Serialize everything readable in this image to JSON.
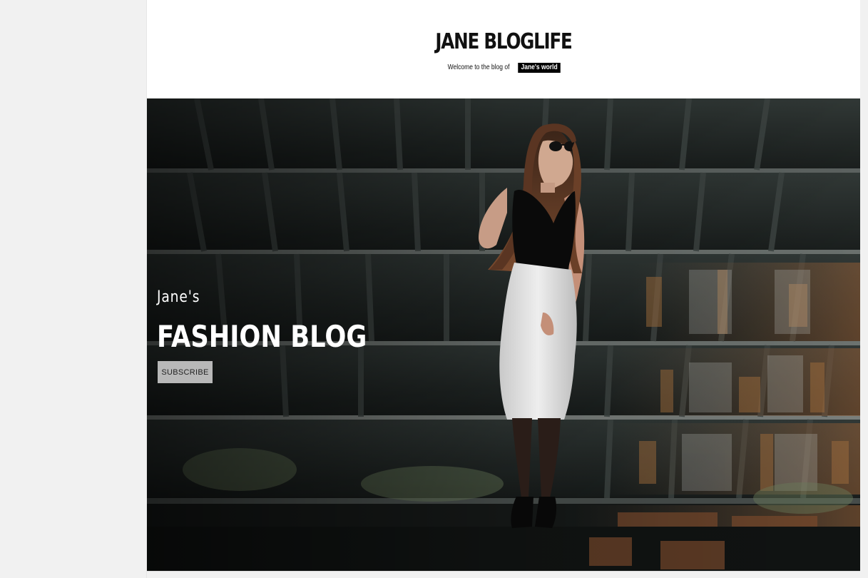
{
  "header": {
    "site_title": "JANE BLOGLIFE",
    "tagline_prefix": "Welcome to the blog of",
    "tagline_highlight": "Jane's world"
  },
  "hero": {
    "kicker": "Jane's",
    "title": "FASHION BLOG",
    "subscribe_label": "SUBSCRIBE",
    "image_alt": "woman-in-white-skirt-industrial-backdrop"
  },
  "colors": {
    "page_background": "#f1f1f1",
    "header_background": "#ffffff",
    "tagline_highlight_bg": "#000000",
    "button_bg": "#b8b8b8",
    "hero_text": "#ffffff"
  }
}
